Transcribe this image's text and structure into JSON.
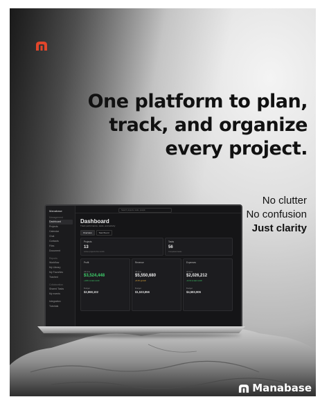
{
  "poster": {
    "headline_lines": [
      "One platform to plan,",
      "track, and organize",
      "every project."
    ],
    "tagline_lines": [
      "No clutter",
      "No confusion",
      "Just clarity"
    ],
    "brand_name": "Manabase",
    "brand_color": "#e2462b",
    "logo_icon": "manabase-logo-icon"
  },
  "app": {
    "brand": "Manabase",
    "search_placeholder": "Search projects, tasks, people",
    "sidebar": {
      "section_main": "Management",
      "items_main": [
        "Dashboard",
        "Projects",
        "Calendar",
        "Chat",
        "Contacts",
        "Files",
        "Document"
      ],
      "section_reports": "Reports",
      "items_reports": [
        "Workflow",
        "My Library",
        "My Favorites",
        "Trashed"
      ],
      "section_collab": "Collaboration",
      "items_collab": [
        "Shared Tasks",
        "My events"
      ],
      "bottom_items": [
        "Integration",
        "Tutorials"
      ]
    },
    "dashboard": {
      "title": "Dashboard",
      "subtitle": "Track performance, tasks, and activity",
      "tabs": [
        "Overview",
        "Task Board"
      ],
      "projects": {
        "label": "Projects",
        "value": "13",
        "note": "Active projects this month"
      },
      "tasks": {
        "label": "Tasks",
        "value": "56",
        "note": "Completed tasks"
      },
      "profit": {
        "label": "Profit",
        "row1_label": "All time",
        "row1_value": "$3,524,448",
        "row1_note": "+12% vs last month",
        "row2_label": "Budget",
        "row2_value": "$2,868,102"
      },
      "revenue": {
        "label": "Revenue",
        "row1_label": "All time",
        "row1_value": "$5,550,680",
        "row1_note": "+8.4% growth",
        "row2_label": "Budget",
        "row2_value": "$1,533,856"
      },
      "expenses": {
        "label": "Expenses",
        "row1_label": "All time",
        "row1_value": "$2,026,212",
        "row1_note": "-4.1% vs last month",
        "row2_label": "Budget",
        "row2_value": "$4,583,906"
      }
    },
    "colors": {
      "positive": "#3fcf6b",
      "background": "#151517"
    }
  }
}
